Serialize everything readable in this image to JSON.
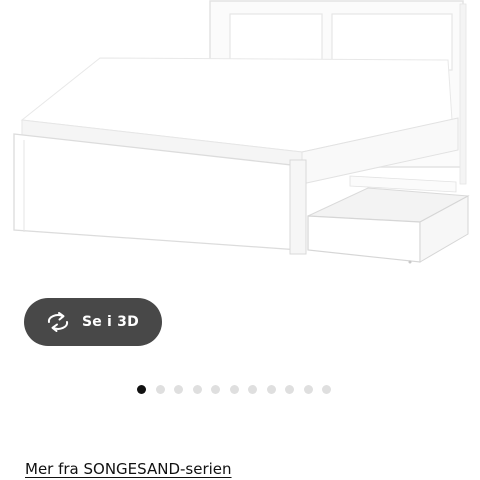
{
  "gallery": {
    "image_name": "bed-frame-with-storage-drawer-icon",
    "total_images": 11,
    "active_index": 0
  },
  "view_3d": {
    "label": "Se i 3D",
    "icon": "rotate-3d-icon"
  },
  "series_link": {
    "label": "Mer fra SONGESAND-serien"
  }
}
